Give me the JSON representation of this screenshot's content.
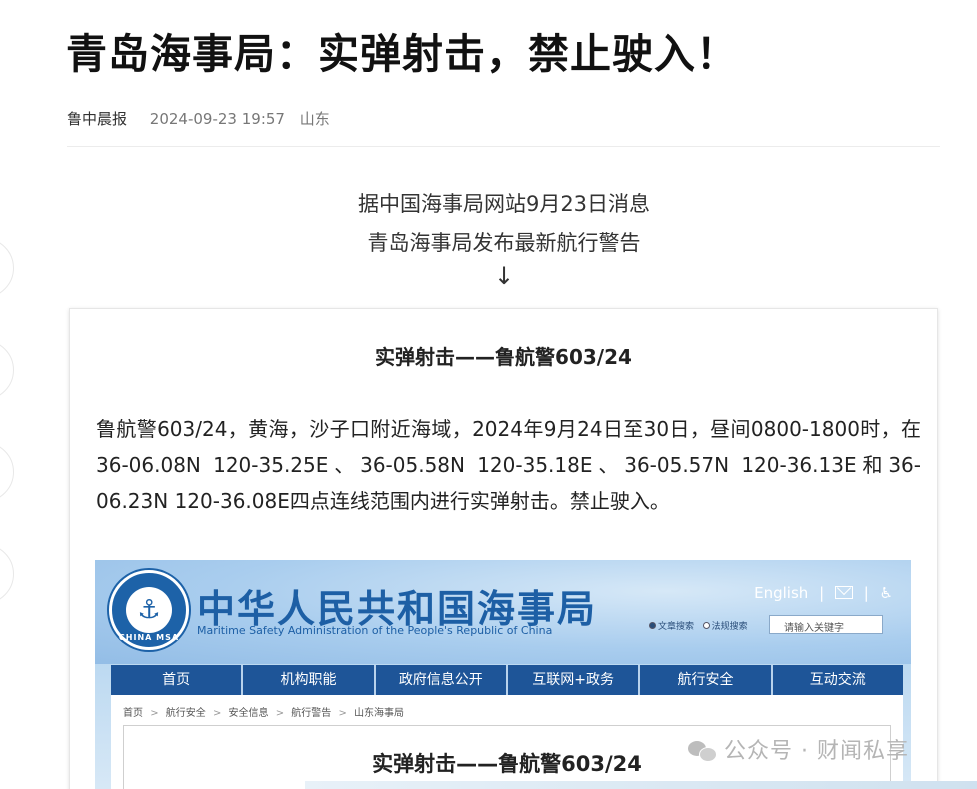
{
  "article": {
    "title": "青岛海事局：实弹射击，禁止驶入！",
    "author": "鲁中晨报",
    "datetime": "2024-09-23 19:57",
    "location": "山东",
    "intro_line1": "据中国海事局网站9月23日消息",
    "intro_line2": "青岛海事局发布最新航行警告",
    "arrow": "↓"
  },
  "notice": {
    "title": "实弹射击——鲁航警603/24",
    "body": "鲁航警603/24，黄海，沙子口附近海域，2024年9月24日至30日，昼间0800-1800时，在36-06.08N 120-35.25E、36-05.58N 120-35.18E、36-05.57N 120-36.13E和36-06.23N 120-36.08E四点连线范围内进行实弹射击。禁止驶入。"
  },
  "msa_site": {
    "seal_text": "CHINA MSA",
    "name_cn": "中华人民共和国海事局",
    "name_en": "Maritime Safety Administration of the People's Republic of China",
    "link_english": "English",
    "separator": "|",
    "search_option_1": "文章搜索",
    "search_option_2": "法规搜索",
    "search_placeholder": "请输入关键字",
    "nav": [
      "首页",
      "机构职能",
      "政府信息公开",
      "互联网+政务",
      "航行安全",
      "互动交流"
    ],
    "breadcrumb": [
      "首页",
      "航行安全",
      "安全信息",
      "航行警告",
      "山东海事局"
    ],
    "breadcrumb_sep": ">",
    "article_title": "实弹射击——鲁航警603/24"
  },
  "watermark": {
    "text": "公众号 · 财闻私享"
  },
  "icons": {
    "anchor": "anchor-icon",
    "mail": "mail-icon",
    "accessibility": "accessibility-icon",
    "wechat": "wechat-icon"
  },
  "colors": {
    "msa_blue": "#1d5fa5",
    "nav_blue": "#1e5598"
  }
}
